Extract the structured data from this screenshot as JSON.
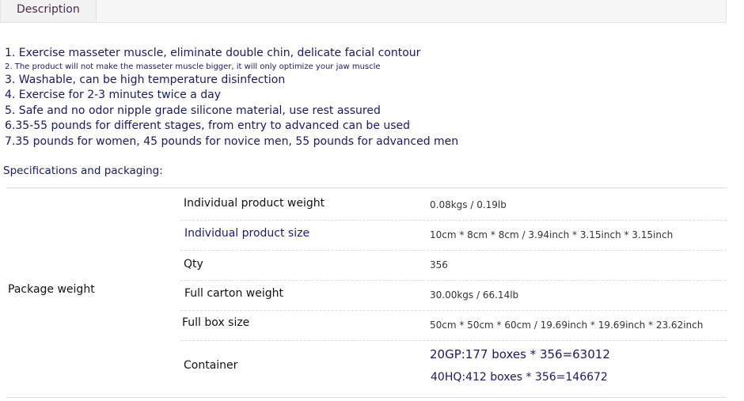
{
  "tabs": {
    "description": "Description"
  },
  "features": [
    "1. Exercise masseter muscle, eliminate double chin, delicate facial contour",
    "2. The product will not make the masseter muscle bigger, it will only optimize your jaw muscle",
    "3. Washable, can be high temperature disinfection",
    "4. Exercise for 2-3 minutes twice a day",
    "5. Safe and no odor nipple grade silicone material, use rest assured",
    "6.35-55 pounds for different stages, from entry to advanced can be used",
    "7.35 pounds for women, 45 pounds for novice men, 55 pounds for advanced men"
  ],
  "specs": {
    "title": "Specifications and packaging:",
    "group_label": "Package weight",
    "rows": [
      {
        "label": "Individual product weight",
        "value": "0.08kgs / 0.19lb"
      },
      {
        "label": "Individual product size",
        "value": "10cm * 8cm * 8cm / 3.94inch * 3.15inch * 3.15inch"
      },
      {
        "label": "Qty",
        "value": "356"
      },
      {
        "label": "Full carton weight",
        "value": "30.00kgs / 66.14lb"
      },
      {
        "label": "Full box size",
        "value": "50cm * 50cm * 60cm / 19.69inch * 19.69inch * 23.62inch"
      },
      {
        "label": "Container",
        "value_1": "20GP:177 boxes * 356=63012",
        "value_2": "40HQ:412 boxes * 356=146672"
      }
    ]
  }
}
